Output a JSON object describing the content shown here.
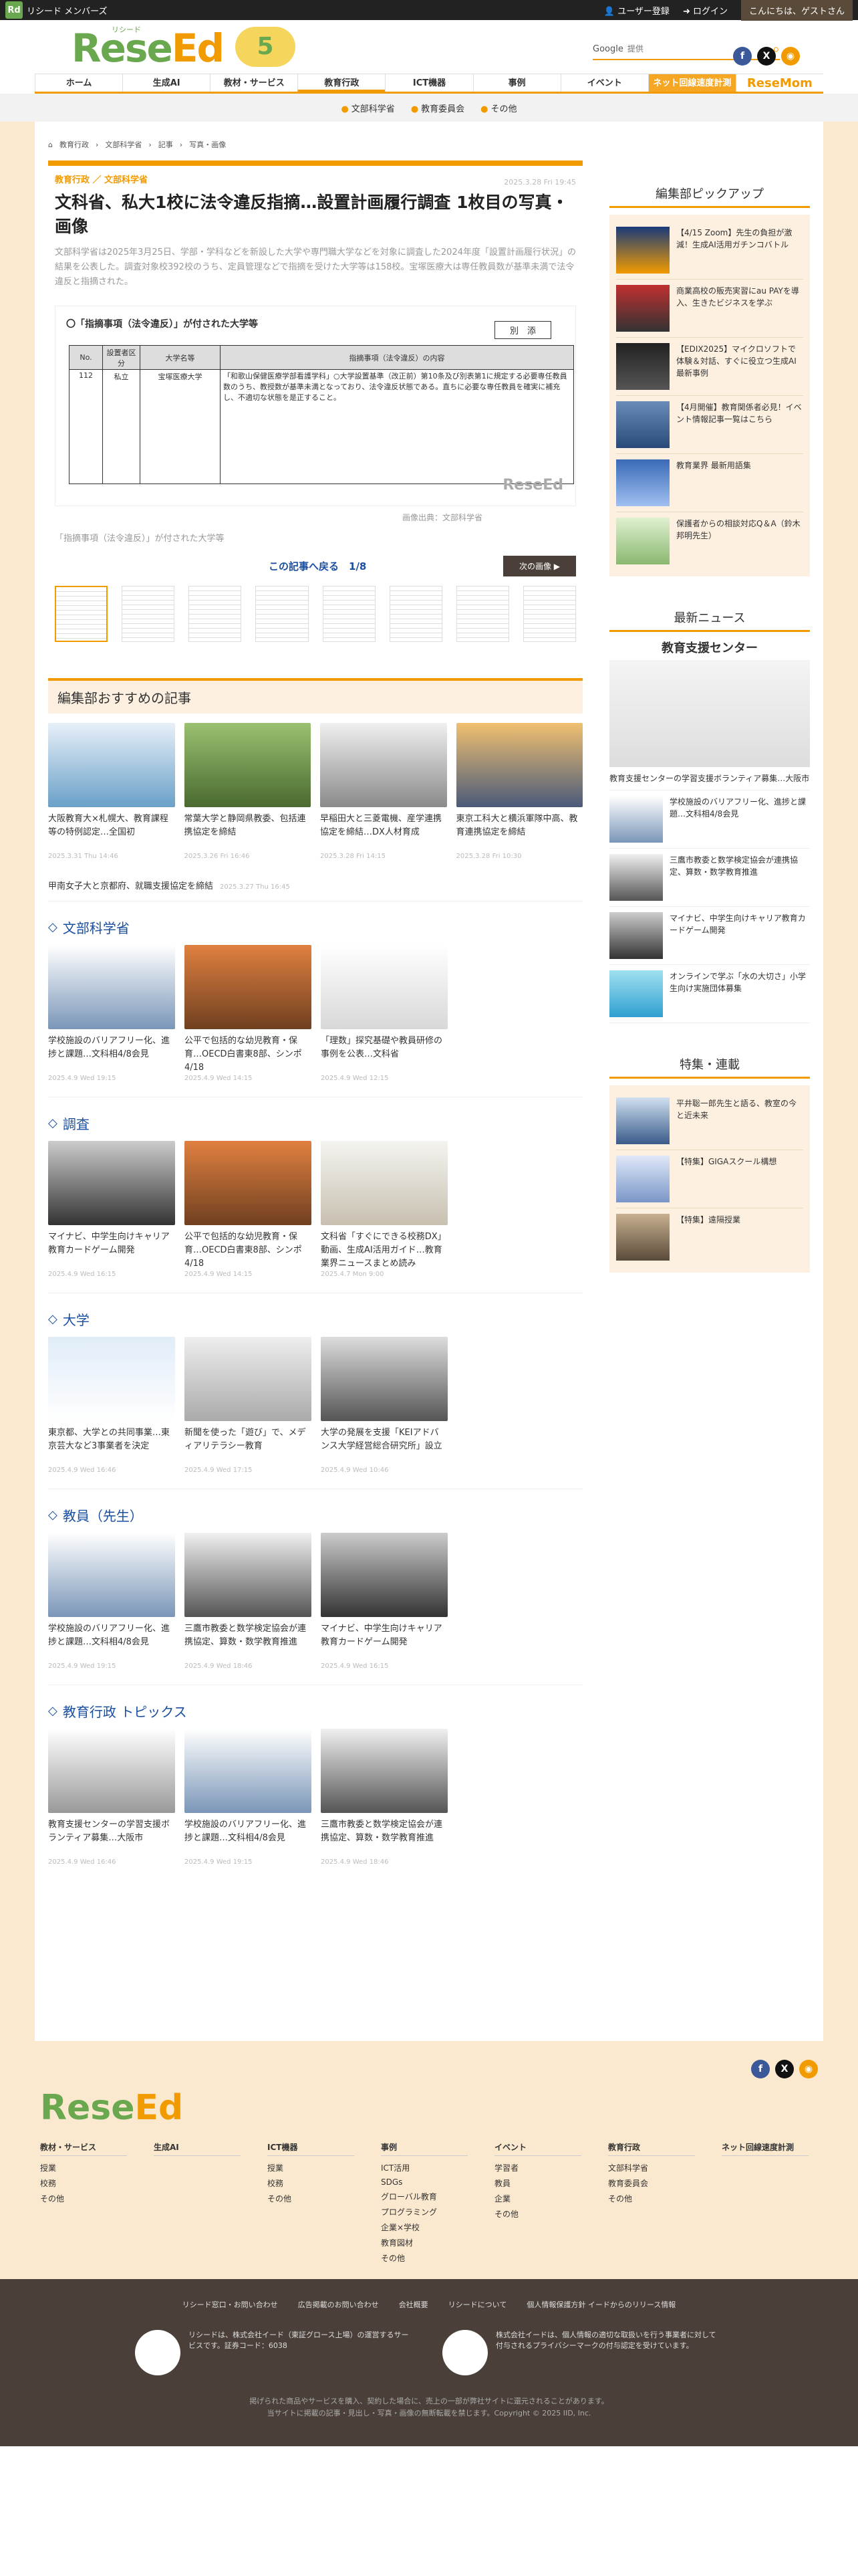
{
  "topbar": {
    "brand": "Rd",
    "member": "リシード メンバーズ",
    "register": "ユーザー登録",
    "login": "ログイン",
    "greeting": "こんにちは、ゲストさん"
  },
  "header": {
    "logo_a": "Rese",
    "logo_b": "Ed",
    "logo_sub": "リシード",
    "anniv": "5",
    "search_label": "Google",
    "search_placeholder": "提供"
  },
  "nav": [
    "ホーム",
    "生成AI",
    "教材・サービス",
    "教育行政",
    "ICT機器",
    "事例",
    "イベント",
    "ネット回線速度計測",
    "ReseMom"
  ],
  "subnav": [
    "文部科学省",
    "教育委員会",
    "その他"
  ],
  "breadcrumb": [
    "教育行政",
    "文部科学省",
    "記事",
    "写真・画像"
  ],
  "article": {
    "cat": "教育行政 ／ 文部科学省",
    "date": "2025.3.28 Fri 19:45",
    "title": "文科省、私大1校に法令違反指摘…設置計画履行調査 1枚目の写真・画像",
    "lead": "文部科学省は2025年3月25日、学部・学科などを新設した大学や専門職大学などを対象に調査した2024年度「設置計画履行状況」の結果を公表した。調査対象校392校のうち、定員管理などで指摘を受けた大学等は158校。宝塚医療大は専任教員数が基準未満で法令違反と指摘された。"
  },
  "doc": {
    "title": "〇「指摘事項（法令違反）」が付された大学等",
    "btn": "別　添",
    "h_no": "No.",
    "h_type": "設置者区分",
    "h_name": "大学名等",
    "h_content": "指摘事項（法令違反）の内容",
    "no": "112",
    "type": "私立",
    "name": "宝塚医療大学",
    "content": "「和歌山保健医療学部看護学科」○大学設置基準（改正前）第10条及び別表第1に規定する必要専任教員数のうち、教授数が基準未満となっており、法令違反状態である。直ちに必要な専任教員を確実に補充し、不適切な状態を是正すること。",
    "wm": "ReseEd"
  },
  "credit": "画像出典：文部科学省",
  "caption": "「指摘事項（法令違反）」が付された大学等",
  "pager": {
    "back": "この記事へ戻る　1/8",
    "next": "次の画像 ▶"
  },
  "rec_title": "編集部おすすめの記事",
  "rec": [
    {
      "t": "大阪教育大×札幌大、教育課程等の特例認定…全国初",
      "d": "2025.3.31 Thu 14:46"
    },
    {
      "t": "常葉大学と静岡県教委、包括連携協定を締結",
      "d": "2025.3.26 Fri 16:46"
    },
    {
      "t": "早稲田大と三菱電機、産学連携協定を締結…DX人材育成",
      "d": "2025.3.28 Fri 14:15"
    },
    {
      "t": "東京工科大と横浜軍隊中高、教育連携協定を締結",
      "d": "2025.3.28 Fri 10:30"
    }
  ],
  "rec_line": {
    "t": "甲南女子大と京都府、就職支援協定を締結",
    "d": "2025.3.27 Thu 16:45"
  },
  "sections": [
    {
      "title": "文部科学省",
      "items": [
        {
          "t": "学校施設のバリアフリー化、進捗と課題…文科相4/8会見",
          "d": "2025.4.9 Wed 19:15"
        },
        {
          "t": "公平で包括的な幼児教育・保育…OECD白書東8部、シンポ4/18",
          "d": "2025.4.9 Wed 14:15"
        },
        {
          "t": "「理数」探究基礎や教員研修の事例を公表…文科省",
          "d": "2025.4.9 Wed 12:15"
        }
      ]
    },
    {
      "title": "調査",
      "items": [
        {
          "t": "マイナビ、中学生向けキャリア教育カードゲーム開発",
          "d": "2025.4.9 Wed 16:15"
        },
        {
          "t": "公平で包括的な幼児教育・保育…OECD白書東8部、シンポ4/18",
          "d": "2025.4.9 Wed 14:15"
        },
        {
          "t": "文科省「すぐにできる校務DX」動画、生成AI活用ガイド…教育業界ニュースまとめ読み",
          "d": "2025.4.7 Mon 9:00"
        }
      ]
    },
    {
      "title": "大学",
      "items": [
        {
          "t": "東京都、大学との共同事業…東京芸大など3事業者を決定",
          "d": "2025.4.9 Wed 16:46"
        },
        {
          "t": "新聞を使った「遊び」で、メディアリテラシー教育",
          "d": "2025.4.9 Wed 17:15"
        },
        {
          "t": "大学の発展を支援「KEIアドバンス大学経営総合研究所」設立",
          "d": "2025.4.9 Wed 10:46"
        }
      ]
    },
    {
      "title": "教員（先生）",
      "items": [
        {
          "t": "学校施設のバリアフリー化、進捗と課題…文科相4/8会見",
          "d": "2025.4.9 Wed 19:15"
        },
        {
          "t": "三鷹市教委と数学検定協会が連携協定、算数・数学教育推進",
          "d": "2025.4.9 Wed 18:46"
        },
        {
          "t": "マイナビ、中学生向けキャリア教育カードゲーム開発",
          "d": "2025.4.9 Wed 16:15"
        }
      ]
    },
    {
      "title": "教育行政 トピックス",
      "items": [
        {
          "t": "教育支援センターの学習支援ボランティア募集…大阪市",
          "d": "2025.4.9 Wed 16:46"
        },
        {
          "t": "学校施設のバリアフリー化、進捗と課題…文科相4/8会見",
          "d": "2025.4.9 Wed 19:15"
        },
        {
          "t": "三鷹市教委と数学検定協会が連携協定、算数・数学教育推進",
          "d": "2025.4.9 Wed 18:46"
        }
      ]
    }
  ],
  "side": {
    "pickup_title": "編集部ピックアップ",
    "pickup": [
      "【4/15 Zoom】先生の負担が激減！生成AI活用ガチンコバトル",
      "商業高校の販売実習にau PAYを導入、生きたビジネスを学ぶ",
      "【EDIX2025】マイクロソフトで体験＆対話、すぐに役立つ生成AI最新事例",
      "【4月開催】教育関係者必見！イベント情報記事一覧はこちら",
      "教育業界 最新用語集",
      "保護者からの相談対応Q＆A（鈴木邦明先生）"
    ],
    "news_title": "最新ニュース",
    "big_title": "教育支援センター",
    "big_cap": "教育支援センターの学習支援ボランティア募集…大阪市",
    "news": [
      "学校施設のバリアフリー化、進捗と課題…文科相4/8会見",
      "三鷹市教委と数学検定協会が連携協定、算数・数学教育推進",
      "マイナビ、中学生向けキャリア教育カードゲーム開発",
      "オンラインで学ぶ「水の大切さ」小学生向け実施団体募集"
    ],
    "feature_title": "特集・連載",
    "feature": [
      "平井聡一郎先生と語る、教室の今と近未来",
      "【特集】GIGAスクール構想",
      "【特集】遠隔授業"
    ]
  },
  "footer": {
    "cols": [
      {
        "h": "教材・サービス",
        "i": [
          "授業",
          "校務",
          "その他"
        ]
      },
      {
        "h": "生成AI",
        "i": []
      },
      {
        "h": "ICT機器",
        "i": [
          "授業",
          "校務",
          "その他"
        ]
      },
      {
        "h": "事例",
        "i": [
          "ICT活用",
          "SDGs",
          "グローバル教育",
          "プログラミング",
          "企業×学校",
          "教育図材",
          "その他"
        ]
      },
      {
        "h": "イベント",
        "i": [
          "学習者",
          "教員",
          "企業",
          "その他"
        ]
      },
      {
        "h": "教育行政",
        "i": [
          "文部科学省",
          "教育委員会",
          "その他"
        ]
      },
      {
        "h": "ネット回線速度計測",
        "i": []
      }
    ],
    "links": [
      "リシード窓口・お問い合わせ",
      "広告掲載のお問い合わせ",
      "会社概要",
      "リシードについて",
      "個人情報保護方針 イードからのリリース情報"
    ],
    "box1": "リシードは、株式会社イード（東証グロース上場）の運営するサービスです。証券コード：6038",
    "box2": "株式会社イードは、個人情報の適切な取扱いを行う事業者に対して付与されるプライバシーマークの付与認定を受けています。",
    "copy1": "掲げられた商品やサービスを購入、契約した場合に、売上の一部が弊社サイトに還元されることがあります。",
    "copy2": "当サイトに掲載の記事・見出し・写真・画像の無断転載を禁じます。Copyright © 2025 IID, Inc."
  }
}
